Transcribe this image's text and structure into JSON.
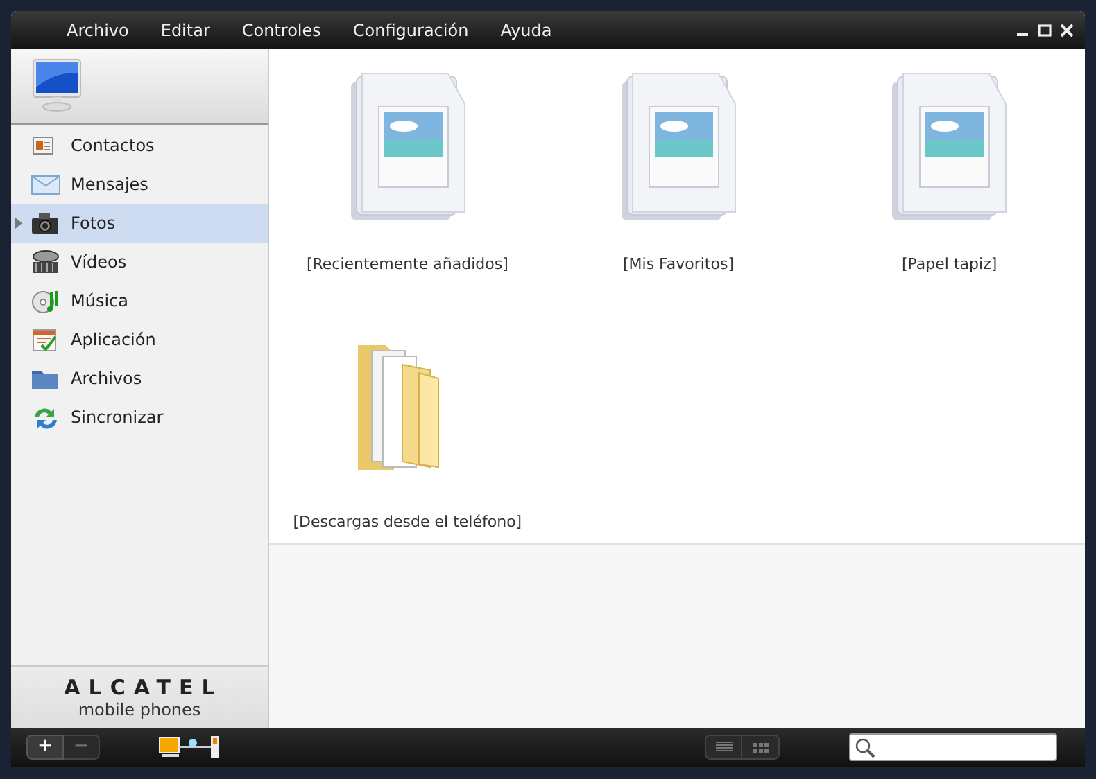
{
  "menu": [
    "Archivo",
    "Editar",
    "Controles",
    "Configuración",
    "Ayuda"
  ],
  "sidebar": {
    "items": [
      {
        "label": "Contactos",
        "kind": "contacts",
        "selected": false
      },
      {
        "label": "Mensajes",
        "kind": "messages",
        "selected": false
      },
      {
        "label": "Fotos",
        "kind": "photos",
        "selected": true
      },
      {
        "label": "Vídeos",
        "kind": "videos",
        "selected": false
      },
      {
        "label": "Música",
        "kind": "music",
        "selected": false
      },
      {
        "label": "Aplicación",
        "kind": "apps",
        "selected": false
      },
      {
        "label": "Archivos",
        "kind": "files",
        "selected": false
      },
      {
        "label": "Sincronizar",
        "kind": "sync",
        "selected": false
      }
    ],
    "brand": "ALCATEL",
    "brand_sub": "mobile phones"
  },
  "albums": [
    {
      "label": "[Recientemente añadidos]",
      "kind": "album"
    },
    {
      "label": "[Mis Favoritos]",
      "kind": "album"
    },
    {
      "label": "[Papel tapiz]",
      "kind": "album"
    },
    {
      "label": "[Descargas desde el teléfono]",
      "kind": "folder"
    }
  ],
  "bottom_bar": {
    "zoom_in": "+",
    "zoom_out": "−"
  }
}
